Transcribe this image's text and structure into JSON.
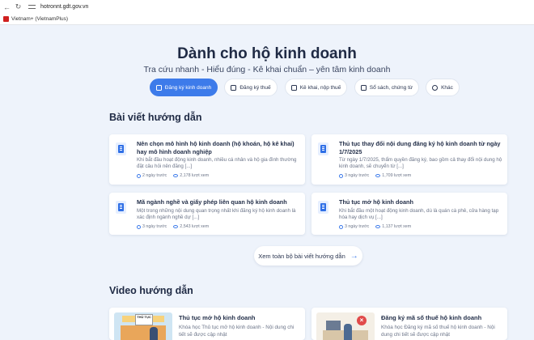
{
  "browser": {
    "url": "hotronnt.gdt.gov.vn",
    "bookmark": "Vietnam+ (VietnamPlus)"
  },
  "hero": {
    "title": "Dành cho hộ kinh doanh",
    "subtitle": "Tra cứu nhanh - Hiểu đúng - Kê khai chuẩn – yên tâm kinh doanh"
  },
  "tabs": [
    {
      "label": "Đăng ký kinh doanh",
      "icon": "document-icon",
      "active": true
    },
    {
      "label": "Đăng ký thuế",
      "icon": "receipt-icon",
      "active": false
    },
    {
      "label": "Kê khai, nộp thuế",
      "icon": "building-icon",
      "active": false
    },
    {
      "label": "Sổ sách, chứng từ",
      "icon": "ledger-icon",
      "active": false
    },
    {
      "label": "Khác",
      "icon": "more-icon",
      "active": false
    }
  ],
  "guides": {
    "section_title": "Bài viết hướng dẫn",
    "articles": [
      {
        "title": "Nên chọn mô hình hộ kinh doanh (hộ khoán, hộ kê khai) hay mô hình doanh nghiệp",
        "desc": "Khi bắt đầu hoạt động kinh doanh, nhiều cá nhân và hộ gia đình thường đặt câu hỏi nên đăng [...]",
        "time": "2 ngày trước",
        "views": "2,178 lượt xem"
      },
      {
        "title": "Thủ tục thay đổi nội dung đăng ký hộ kinh doanh từ ngày 1/7/2025",
        "desc": "Từ ngày 1/7/2025, thẩm quyền đăng ký, bao gồm cả thay đổi nội dung hộ kinh doanh, sẽ chuyển từ [...]",
        "time": "3 ngày trước",
        "views": "1,709 lượt xem"
      },
      {
        "title": "Mã ngành nghề và giấy phép liên quan hộ kinh doanh",
        "desc": "Một trong những nội dung quan trọng nhất khi đăng ký hộ kinh doanh là xác định ngành nghề dự [...]",
        "time": "3 ngày trước",
        "views": "2,543 lượt xem"
      },
      {
        "title": "Thủ tục mở hộ kinh doanh",
        "desc": "Khi bắt đầu một hoạt động kinh doanh, dù là quán cà phê, cửa hàng tạp hóa hay dịch vụ [...]",
        "time": "3 ngày trước",
        "views": "1,137 lượt xem"
      }
    ],
    "more_label": "Xem toàn bộ bài viết hướng dẫn"
  },
  "videos": {
    "section_title": "Video hướng dẫn",
    "items": [
      {
        "title": "Thủ tục mở hộ kinh doanh",
        "desc": "Khóa học Thủ tục mở hộ kinh doanh - Nội dung chi tiết sẽ được cập nhật",
        "thumb_sign": "THỦ TỤC"
      },
      {
        "title": "Đăng ký mã số thuế hộ kinh doanh",
        "desc": "Khóa học Đăng ký mã số thuế hộ kinh doanh - Nội dung chi tiết sẽ được cập nhật"
      }
    ]
  },
  "colors": {
    "accent": "#3d7bea",
    "background": "#eef3fb",
    "heading": "#1f2a44"
  }
}
